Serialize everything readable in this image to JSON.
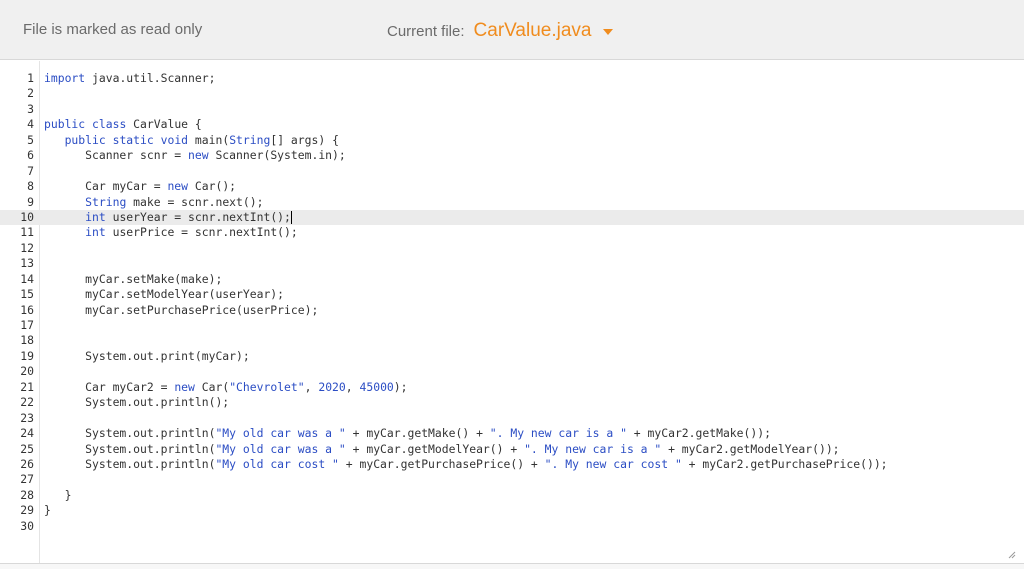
{
  "header": {
    "readonly_text": "File is marked as read only",
    "current_label": "Current file:",
    "filename": "CarValue.java"
  },
  "editor": {
    "active_line": 10,
    "lines": [
      {
        "n": "1",
        "t": "import java.util.Scanner;"
      },
      {
        "n": "2",
        "t": ""
      },
      {
        "n": "3",
        "t": ""
      },
      {
        "n": "4",
        "t": "public class CarValue {"
      },
      {
        "n": "5",
        "t": "   public static void main(String[] args) {"
      },
      {
        "n": "6",
        "t": "      Scanner scnr = new Scanner(System.in);"
      },
      {
        "n": "7",
        "t": ""
      },
      {
        "n": "8",
        "t": "      Car myCar = new Car();"
      },
      {
        "n": "9",
        "t": "      String make = scnr.next();"
      },
      {
        "n": "10",
        "t": "      int userYear = scnr.nextInt();"
      },
      {
        "n": "11",
        "t": "      int userPrice = scnr.nextInt();"
      },
      {
        "n": "12",
        "t": ""
      },
      {
        "n": "13",
        "t": ""
      },
      {
        "n": "14",
        "t": "      myCar.setMake(make);"
      },
      {
        "n": "15",
        "t": "      myCar.setModelYear(userYear);"
      },
      {
        "n": "16",
        "t": "      myCar.setPurchasePrice(userPrice);"
      },
      {
        "n": "17",
        "t": ""
      },
      {
        "n": "18",
        "t": ""
      },
      {
        "n": "19",
        "t": "      System.out.print(myCar);"
      },
      {
        "n": "20",
        "t": ""
      },
      {
        "n": "21",
        "t": "      Car myCar2 = new Car(\"Chevrolet\", 2020, 45000);"
      },
      {
        "n": "22",
        "t": "      System.out.println();"
      },
      {
        "n": "23",
        "t": ""
      },
      {
        "n": "24",
        "t": "      System.out.println(\"My old car was a \" + myCar.getMake() + \". My new car is a \" + myCar2.getMake());"
      },
      {
        "n": "25",
        "t": "      System.out.println(\"My old car was a \" + myCar.getModelYear() + \". My new car is a \" + myCar2.getModelYear());"
      },
      {
        "n": "26",
        "t": "      System.out.println(\"My old car cost \" + myCar.getPurchasePrice() + \". My new car cost \" + myCar2.getPurchasePrice());"
      },
      {
        "n": "27",
        "t": ""
      },
      {
        "n": "28",
        "t": "   }"
      },
      {
        "n": "29",
        "t": "}"
      },
      {
        "n": "30",
        "t": ""
      }
    ]
  },
  "colors": {
    "accent": "#f08c1e",
    "keyword": "#2b4dc4",
    "header_bg": "#f0f0f0"
  },
  "icons": {
    "dropdown": "chevron-down-icon",
    "resize": "resize-grip-icon"
  }
}
